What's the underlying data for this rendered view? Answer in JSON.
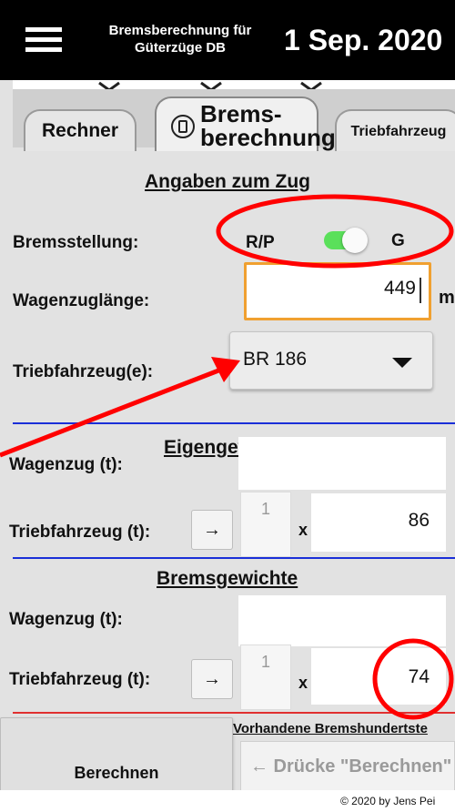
{
  "header": {
    "title_line1": "Bremsberechnung für",
    "title_line2": "Güterzüge DB",
    "date": "1 Sep. 2020"
  },
  "tabs": [
    {
      "label": "Rechner"
    },
    {
      "label_line1": "Brems-",
      "label_line2": "berechnung",
      "active": true
    },
    {
      "label": "Triebfahrzeug"
    }
  ],
  "train": {
    "section_title": "Angaben zum Zug",
    "brake_label": "Bremsstellung:",
    "brake_left": "R/P",
    "brake_right": "G",
    "brake_toggle_on": true,
    "length_label": "Wagenzuglänge:",
    "length_value": "449",
    "length_unit": "m",
    "loco_label": "Triebfahrzeug(e):",
    "loco_value": "BR 186"
  },
  "own_weights": {
    "section_title": "Eigengewichte",
    "wagon_label": "Wagenzug (t):",
    "wagon_value": "",
    "loco_label": "Triebfahrzeug (t):",
    "loco_count": "1",
    "multiply": "x",
    "loco_value": "86",
    "arrow": "→"
  },
  "brake_weights": {
    "section_title": "Bremsgewichte",
    "wagon_label": "Wagenzug (t):",
    "wagon_value": "",
    "loco_label": "Triebfahrzeug (t):",
    "loco_count": "1",
    "multiply": "x",
    "loco_value": "74",
    "arrow": "→"
  },
  "result": {
    "title": "Vorhandene Bremshundertste",
    "calc_button": "Berechnen",
    "hint": "← Drücke \"Berechnen\""
  },
  "footer": {
    "copyright": "© 2020 by Jens Pei"
  },
  "colors": {
    "header_bg": "#000000",
    "content_bg": "#e2e2e2",
    "divider_blue": "#1a2fd8",
    "divider_red": "#e03030",
    "toggle_on": "#5ae05a",
    "input_focus": "#f0a030",
    "annotation_red": "#ff0000"
  }
}
